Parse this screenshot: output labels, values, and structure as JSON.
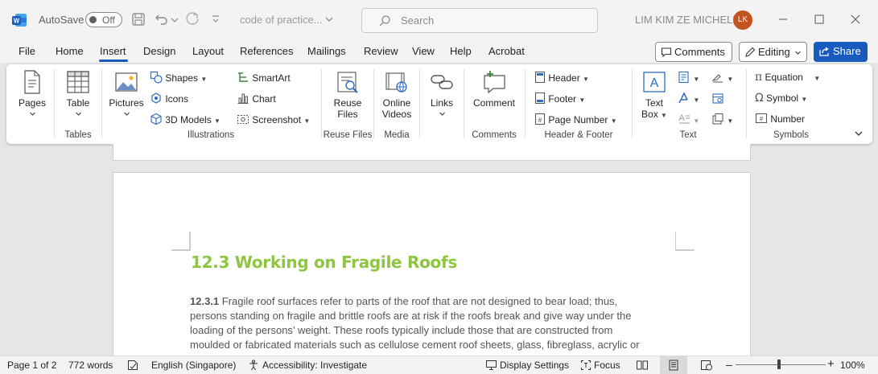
{
  "titlebar": {
    "autosave_label": "AutoSave",
    "autosave_state": "Off",
    "document_title": "code of practice...",
    "search_placeholder": "Search",
    "user_name": "LIM KIM ZE MICHELL",
    "user_initials": "LK"
  },
  "menu": {
    "tabs": [
      "File",
      "Home",
      "Insert",
      "Design",
      "Layout",
      "References",
      "Mailings",
      "Review",
      "View",
      "Help",
      "Acrobat"
    ],
    "active_tab": "Insert",
    "comments_label": "Comments",
    "editing_label": "Editing",
    "share_label": "Share"
  },
  "ribbon": {
    "pages": "Pages",
    "table": "Table",
    "tables_group": "Tables",
    "pictures": "Pictures",
    "shapes": "Shapes",
    "icons": "Icons",
    "models": "3D Models",
    "smartart": "SmartArt",
    "chart": "Chart",
    "screenshot": "Screenshot",
    "illustrations_group": "Illustrations",
    "reuse_files_1": "Reuse",
    "reuse_files_2": "Files",
    "reuse_group": "Reuse Files",
    "online_videos_1": "Online",
    "online_videos_2": "Videos",
    "media_group": "Media",
    "links": "Links",
    "comment": "Comment",
    "comments_group": "Comments",
    "header": "Header",
    "footer": "Footer",
    "page_number": "Page Number",
    "header_footer_group": "Header & Footer",
    "text_box_1": "Text",
    "text_box_2": "Box",
    "text_group": "Text",
    "equation": "Equation",
    "symbol": "Symbol",
    "number": "Number",
    "symbols_group": "Symbols"
  },
  "document": {
    "heading": "12.3 Working on Fragile Roofs",
    "para_number": "12.3.1",
    "para_lines": [
      " Fragile roof surfaces refer to parts of the roof that are not designed to bear load; thus,",
      "persons standing on fragile and brittle roofs are at risk if the roofs break and give way under the",
      "loading of the persons’ weight. These roofs typically include those that are constructed from",
      "moulded or fabricated materials such as cellulose cement roof sheets, glass, fibreglass, acrylic or"
    ],
    "heading_color": "#8dc63f"
  },
  "status": {
    "page": "Page 1 of 2",
    "words": "772 words",
    "language": "English (Singapore)",
    "accessibility": "Accessibility: Investigate",
    "display_settings": "Display Settings",
    "focus": "Focus",
    "zoom": "100%",
    "zoom_level": 1.0
  }
}
